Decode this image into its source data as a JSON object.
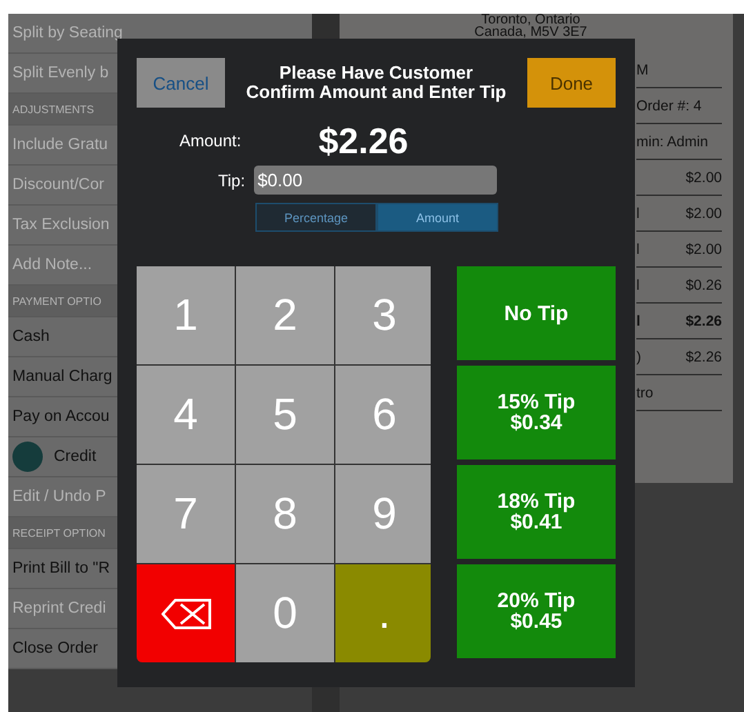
{
  "menu": [
    {
      "kind": "item",
      "label": "Split by Seating",
      "disabled": true
    },
    {
      "kind": "item",
      "label": "Split Evenly b",
      "disabled": true
    },
    {
      "kind": "header",
      "label": "ADJUSTMENTS",
      "disabled": true
    },
    {
      "kind": "item",
      "label": "Include Gratu",
      "disabled": true
    },
    {
      "kind": "item",
      "label": "Discount/Cor",
      "disabled": true
    },
    {
      "kind": "item",
      "label": "Tax Exclusion",
      "disabled": true
    },
    {
      "kind": "item",
      "label": "Add Note...",
      "disabled": true
    },
    {
      "kind": "header",
      "label": "PAYMENT OPTIO",
      "disabled": true
    },
    {
      "kind": "item",
      "label": "Cash",
      "disabled": false
    },
    {
      "kind": "item",
      "label": "Manual Charg",
      "disabled": false
    },
    {
      "kind": "item",
      "label": "Pay on Accou",
      "disabled": false
    },
    {
      "kind": "avatar",
      "label": "Credit",
      "disabled": false
    },
    {
      "kind": "item",
      "label": "Edit / Undo P",
      "disabled": true
    },
    {
      "kind": "header",
      "label": "RECEIPT OPTION",
      "disabled": true
    },
    {
      "kind": "item",
      "label": "Print Bill to \"R",
      "disabled": false
    },
    {
      "kind": "item",
      "label": "Reprint Credi",
      "disabled": true
    },
    {
      "kind": "item",
      "label": "Close Order",
      "disabled": false
    }
  ],
  "receipt": {
    "address": [
      "Toronto, Ontario",
      "Canada, M5V 3E7"
    ],
    "rows": [
      {
        "column_1": "M",
        "amount": ""
      },
      {
        "column_1": "Order #: 4",
        "amount": ""
      },
      {
        "column_1": "min: Admin",
        "amount": ""
      },
      {
        "column_1": "",
        "amount": "$2.00"
      },
      {
        "column_1": "l",
        "amount": "$2.00"
      },
      {
        "column_1": "l",
        "amount": "$2.00"
      },
      {
        "column_1": "l",
        "amount": "$0.26"
      },
      {
        "column_1": "l",
        "amount": "$2.26",
        "bold": true
      },
      {
        "column_1": ")",
        "amount": "$2.26"
      },
      {
        "column_1": "tro",
        "amount": ""
      }
    ]
  },
  "dialog": {
    "title": [
      "Please Have Customer",
      "Confirm Amount and Enter Tip"
    ],
    "cancel": "Cancel",
    "done": "Done",
    "amount_label": "Amount:",
    "amount": "$2.26",
    "tip_label": "Tip:",
    "tip_value": "$0.00",
    "modes": [
      {
        "label": "Percentage",
        "selected": false
      },
      {
        "label": "Amount",
        "selected": true
      }
    ],
    "keys": [
      {
        "kind": "digit",
        "label": "1"
      },
      {
        "kind": "digit",
        "label": "2"
      },
      {
        "kind": "digit",
        "label": "3"
      },
      {
        "kind": "digit",
        "label": "4"
      },
      {
        "kind": "digit",
        "label": "5"
      },
      {
        "kind": "digit",
        "label": "6"
      },
      {
        "kind": "digit",
        "label": "7"
      },
      {
        "kind": "digit",
        "label": "8"
      },
      {
        "kind": "digit",
        "label": "9"
      },
      {
        "kind": "backspace"
      },
      {
        "kind": "digit",
        "label": "0"
      },
      {
        "kind": "decimal",
        "label": "."
      }
    ],
    "tips": [
      [
        "No Tip"
      ],
      [
        "15% Tip",
        "$0.34"
      ],
      [
        "18% Tip",
        "$0.41"
      ],
      [
        "20% Tip",
        "$0.45"
      ]
    ]
  }
}
